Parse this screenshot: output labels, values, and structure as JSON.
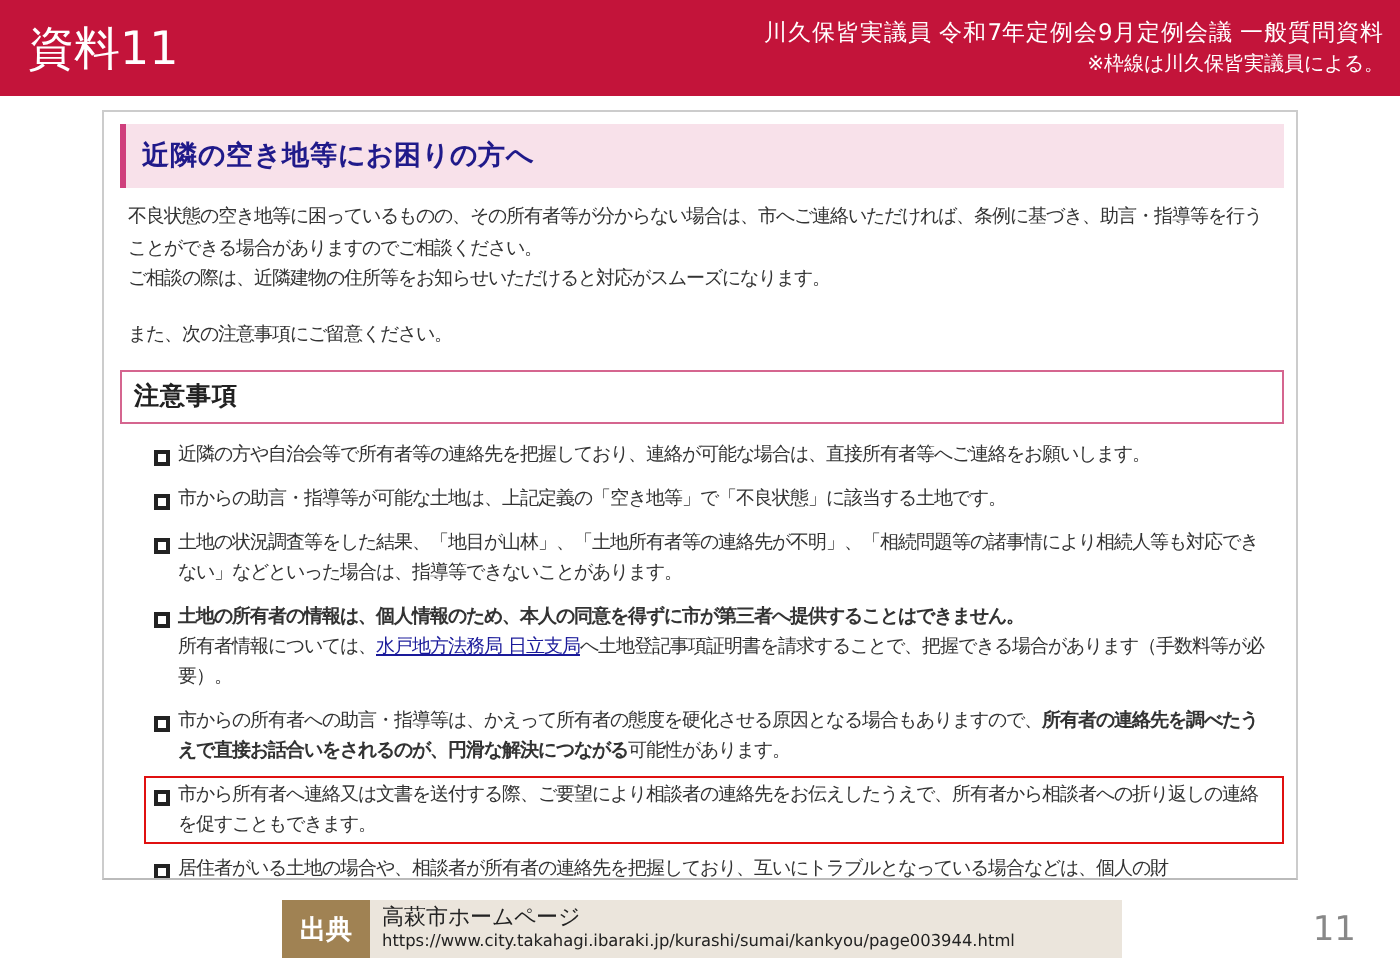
{
  "header": {
    "title": "資料11",
    "subtitle": "川久保皆実議員 令和7年定例会9月定例会議 一般質問資料",
    "note": "※枠線は川久保皆実議員による。"
  },
  "page": {
    "heading": "近隣の空き地等にお困りの方へ",
    "paragraphs": [
      "不良状態の空き地等に困っているものの、その所有者等が分からない場合は、市へご連絡いただければ、条例に基づき、助言・指導等を行うことができる場合がありますのでご相談ください。",
      "ご相談の際は、近隣建物の住所等をお知らせいただけると対応がスムーズになります。",
      "また、次の注意事項にご留意ください。"
    ],
    "section_heading": "注意事項",
    "items": [
      {
        "text": "近隣の方や自治会等で所有者等の連絡先を把握しており、連絡が可能な場合は、直接所有者等へご連絡をお願いします。",
        "highlighted": false
      },
      {
        "text": "市からの助言・指導等が可能な土地は、上記定義の「空き地等」で「不良状態」に該当する土地です。",
        "highlighted": false
      },
      {
        "text": "土地の状況調査等をした結果、「地目が山林」、「土地所有者等の連絡先が不明」、「相続問題等の諸事情により相続人等も対応できない」などといった場合は、指導等できないことがあります。",
        "highlighted": false
      },
      {
        "text": "**土地の所有者の情報は、個人情報のため、本人の同意を得ずに市が第三者へ提供することはできません。**",
        "highlighted": false,
        "note": {
          "before": "所有者情報については、",
          "link": "水戸地方法務局 日立支局",
          "after": "へ土地登記事項証明書を請求することで、把握できる場合があります（手数料等が必要）。"
        }
      },
      {
        "text": "市からの所有者への助言・指導等は、かえって所有者の態度を硬化させる原因となる場合もありますので、**所有者の連絡先を調べたうえで直接お話合いをされるのが、円滑な解決につながる**可能性があります。",
        "highlighted": false
      },
      {
        "text": "市から所有者へ連絡又は文書を送付する際、ご要望により相談者の連絡先をお伝えしたうえで、所有者から相談者への折り返しの連絡を促すこともできます。",
        "highlighted": true
      },
      {
        "text": "居住者がいる土地の場合や、相談者が所有者の連絡先を把握しており、互いにトラブルとなっている場合などは、個人の財",
        "highlighted": false
      }
    ]
  },
  "source": {
    "label": "出典",
    "title": "高萩市ホームページ",
    "url": "https://www.city.takahagi.ibaraki.jp/kurashi/sumai/kankyou/page003944.html"
  },
  "page_number": "11"
}
